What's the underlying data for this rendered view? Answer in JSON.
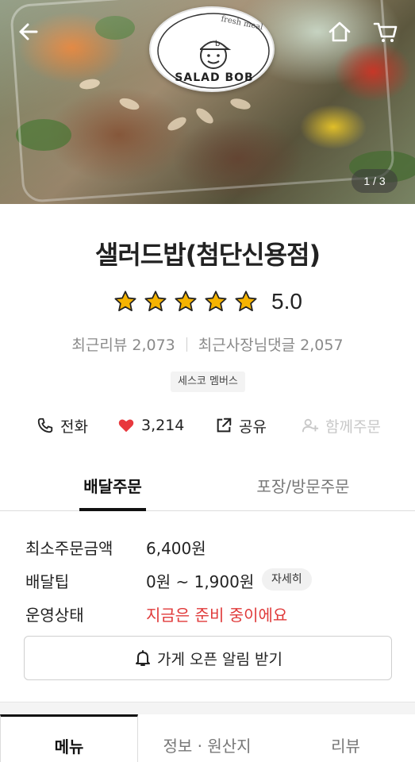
{
  "header": {
    "back_icon": "arrow-left-icon",
    "home_icon": "home-icon",
    "cart_icon": "cart-icon",
    "image_pager": "1 / 3"
  },
  "logo": {
    "brand": "SALAD BOB",
    "tagline": "fresh meal"
  },
  "store": {
    "name": "샐러드밥(첨단신용점)",
    "rating_value": "5.0",
    "rating_stars": 5,
    "recent_reviews": "최근리뷰 2,073",
    "owner_replies": "최근사장님댓글 2,057",
    "badge": "세스코 멤버스"
  },
  "actions": {
    "call": "전화",
    "like_count": "3,214",
    "share": "공유",
    "group_order": "함께주문"
  },
  "order_tabs": {
    "delivery": "배달주문",
    "pickup": "포장/방문주문"
  },
  "info": {
    "min_order_label": "최소주문금액",
    "min_order_value": "6,400원",
    "delivery_tip_label": "배달팁",
    "delivery_tip_value": "0원 ~ 1,900원",
    "detail_chip": "자세히",
    "status_label": "운영상태",
    "status_value": "지금은 준비 중이에요"
  },
  "notify_button": "가게 오픈 알림 받기",
  "menu_tabs": {
    "menu": "메뉴",
    "info": "정보 · 원산지",
    "review": "리뷰"
  },
  "colors": {
    "status_red": "#e03a3a",
    "heart_red": "#e8383d",
    "star_yellow": "#f5b301"
  }
}
